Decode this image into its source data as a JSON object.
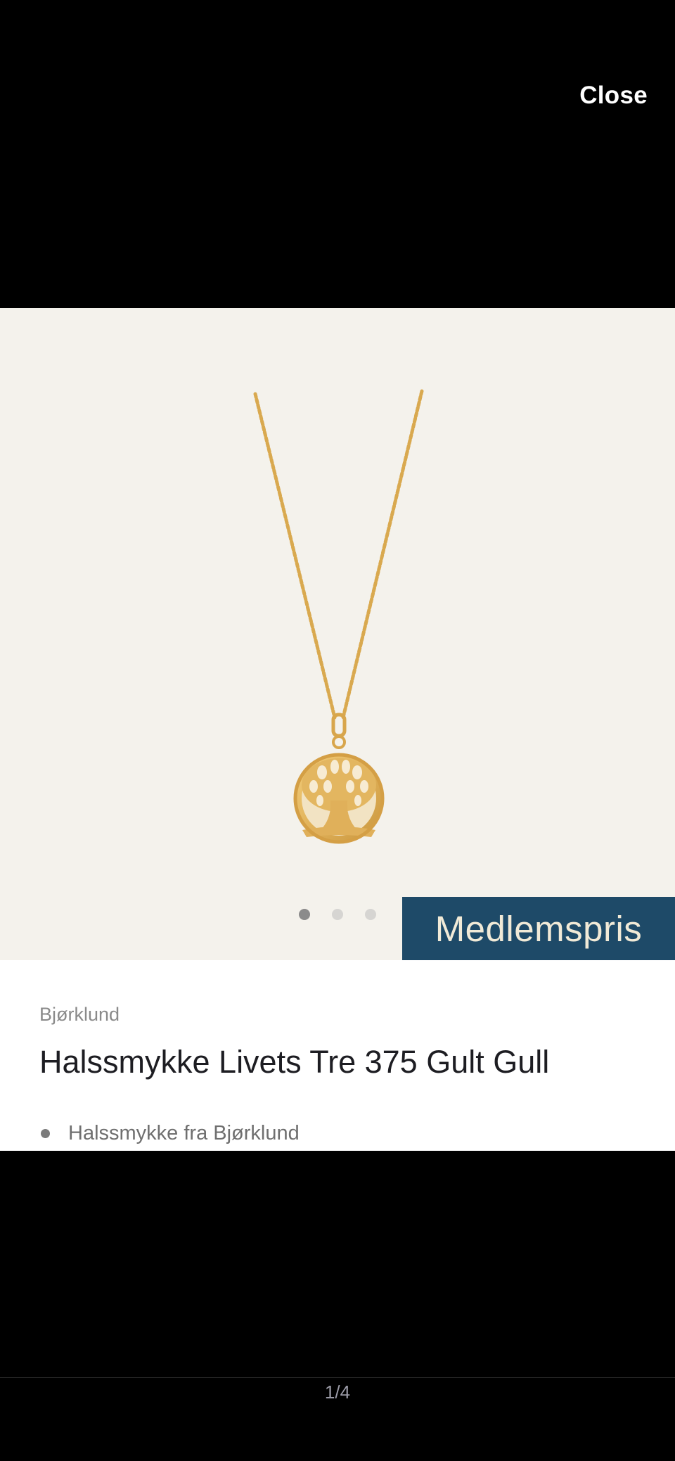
{
  "header": {
    "close_label": "Close"
  },
  "product": {
    "image_alt": "Halssmykke Livets Tre 375 Gult Gull",
    "badge": "Medlemspris",
    "brand": "Bjørklund",
    "title": "Halssmykke Livets Tre 375 Gult Gull",
    "bullets": [
      "Halssmykke fra Bjørklund"
    ]
  },
  "carousel": {
    "dots": 3,
    "active_dot": 1
  },
  "gallery": {
    "counter": "1/4"
  },
  "colors": {
    "background": "#000000",
    "image_bg": "#f4f2ec",
    "badge_bg": "#1e4a68",
    "badge_text": "#f1ead7",
    "gold": "#e1b25a"
  }
}
